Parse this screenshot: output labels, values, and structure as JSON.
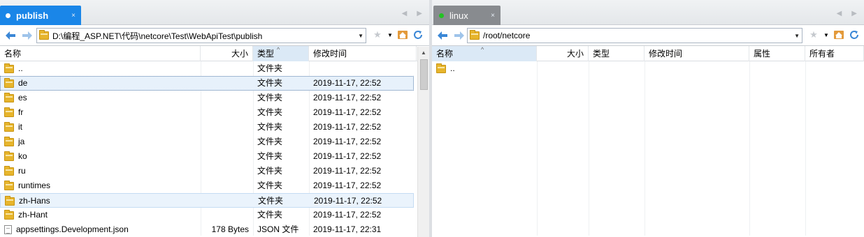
{
  "left": {
    "tab": {
      "label": "publish",
      "close": "×"
    },
    "tab_nav": {
      "prev": "◀",
      "next": "▶"
    },
    "toolbar": {
      "back": "🡐",
      "forward": "🡒",
      "path": "D:\\编程_ASP.NET\\代码\\netcore\\Test\\WebApiTest\\publish",
      "icons": [
        "star-icon",
        "dropdown-icon",
        "home-icon",
        "refresh-icon"
      ]
    },
    "columns": {
      "name": "名称",
      "size": "大小",
      "type": "类型",
      "modified": "修改时间"
    },
    "rows": [
      {
        "name": "..",
        "size": "",
        "type": "文件夹",
        "modified": "",
        "icon": "folder-icon"
      },
      {
        "name": "de",
        "size": "",
        "type": "文件夹",
        "modified": "2019-11-17, 22:52",
        "icon": "folder-icon"
      },
      {
        "name": "es",
        "size": "",
        "type": "文件夹",
        "modified": "2019-11-17, 22:52",
        "icon": "folder-icon"
      },
      {
        "name": "fr",
        "size": "",
        "type": "文件夹",
        "modified": "2019-11-17, 22:52",
        "icon": "folder-icon"
      },
      {
        "name": "it",
        "size": "",
        "type": "文件夹",
        "modified": "2019-11-17, 22:52",
        "icon": "folder-icon"
      },
      {
        "name": "ja",
        "size": "",
        "type": "文件夹",
        "modified": "2019-11-17, 22:52",
        "icon": "folder-icon"
      },
      {
        "name": "ko",
        "size": "",
        "type": "文件夹",
        "modified": "2019-11-17, 22:52",
        "icon": "folder-icon"
      },
      {
        "name": "ru",
        "size": "",
        "type": "文件夹",
        "modified": "2019-11-17, 22:52",
        "icon": "folder-icon"
      },
      {
        "name": "runtimes",
        "size": "",
        "type": "文件夹",
        "modified": "2019-11-17, 22:52",
        "icon": "folder-icon"
      },
      {
        "name": "zh-Hans",
        "size": "",
        "type": "文件夹",
        "modified": "2019-11-17, 22:52",
        "icon": "folder-icon"
      },
      {
        "name": "zh-Hant",
        "size": "",
        "type": "文件夹",
        "modified": "2019-11-17, 22:52",
        "icon": "folder-icon"
      },
      {
        "name": "appsettings.Development.json",
        "size": "178 Bytes",
        "type": "JSON 文件",
        "modified": "2019-11-17, 22:31",
        "icon": "file-icon"
      }
    ]
  },
  "right": {
    "tab": {
      "label": "linux",
      "close": "×"
    },
    "tab_nav": {
      "prev": "◀",
      "next": "▶"
    },
    "toolbar": {
      "back": "🡐",
      "forward": "🡒",
      "path": "/root/netcore",
      "icons": [
        "star-icon",
        "dropdown-icon",
        "home-icon",
        "refresh-icon"
      ]
    },
    "columns": {
      "name": "名称",
      "size": "大小",
      "type": "类型",
      "modified": "修改时间",
      "attributes": "属性",
      "owner": "所有者"
    },
    "rows": [
      {
        "name": "..",
        "icon": "folder-icon"
      }
    ]
  },
  "colors": {
    "active_tab": "#1a86e8",
    "inactive_tab": "#888b8f",
    "connected_dot": "#22c322",
    "folder": "#e7b52c"
  }
}
